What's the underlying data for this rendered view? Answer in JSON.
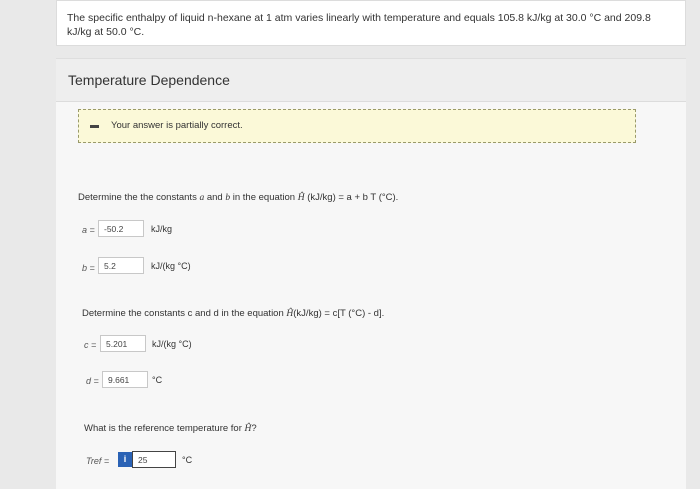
{
  "problem": {
    "text": "The specific enthalpy of liquid n-hexane at 1 atm varies linearly with temperature and equals 105.8 kJ/kg at 30.0 °C and 209.8 kJ/kg at 50.0 °C."
  },
  "section": {
    "title": "Temperature Dependence"
  },
  "feedback": {
    "text": "Your answer is partially correct."
  },
  "part1": {
    "question_prefix": "Determine the the constants ",
    "a": "a",
    "and": " and ",
    "b": "b",
    "question_middle": " in the equation ",
    "h_symbol": "Ĥ",
    "question_suffix": " (kJ/kg) = a + b T (°C).",
    "a_label": "a =",
    "a_value": "-50.2",
    "a_unit": "kJ/kg",
    "b_label": "b =",
    "b_value": "5.2",
    "b_unit": "kJ/(kg °C)"
  },
  "part2": {
    "question_prefix": "Determine the constants c and d in the equation ",
    "h_symbol": "Ĥ",
    "question_suffix": "(kJ/kg) = c[T (°C) - d].",
    "c_label": "c =",
    "c_value": "5.201",
    "c_unit": "kJ/(kg °C)",
    "d_label": "d =",
    "d_value": "9.661",
    "d_unit": "°C"
  },
  "part3": {
    "question_prefix": "What is the reference temperature for ",
    "h_symbol": "Ĥ",
    "question_suffix": "?",
    "tref_label": "Tref =",
    "info_icon": "i",
    "tref_value": "25",
    "tref_unit": "°C"
  },
  "icons": {
    "partial": "minus-icon",
    "info": "info-icon"
  },
  "colors": {
    "feedback_bg": "#fbf9d8",
    "info_badge": "#2a62b5"
  }
}
